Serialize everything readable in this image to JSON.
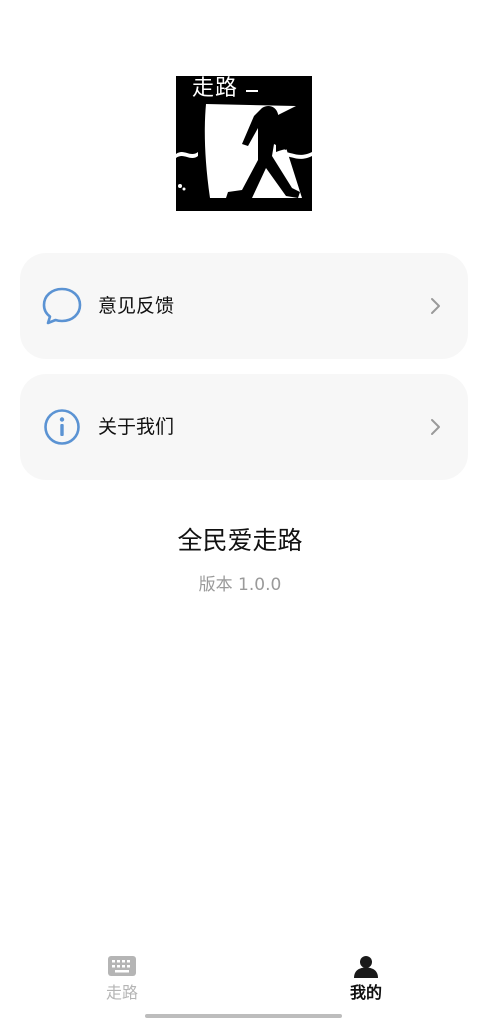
{
  "logo": {
    "text": "走路",
    "icon": "walking-person-icon"
  },
  "menu": [
    {
      "label": "意见反馈",
      "icon": "chat-bubble-icon",
      "accent": "#5b93d3"
    },
    {
      "label": "关于我们",
      "icon": "info-circle-icon",
      "accent": "#5b93d3"
    }
  ],
  "app": {
    "name": "全民爱走路",
    "version": "版本 1.0.0"
  },
  "tabbar": {
    "tabs": [
      {
        "label": "走路",
        "icon": "keyboard-icon",
        "active": false
      },
      {
        "label": "我的",
        "icon": "person-icon",
        "active": true
      }
    ],
    "active_color": "#111111",
    "inactive_color": "#b5b5b5"
  }
}
